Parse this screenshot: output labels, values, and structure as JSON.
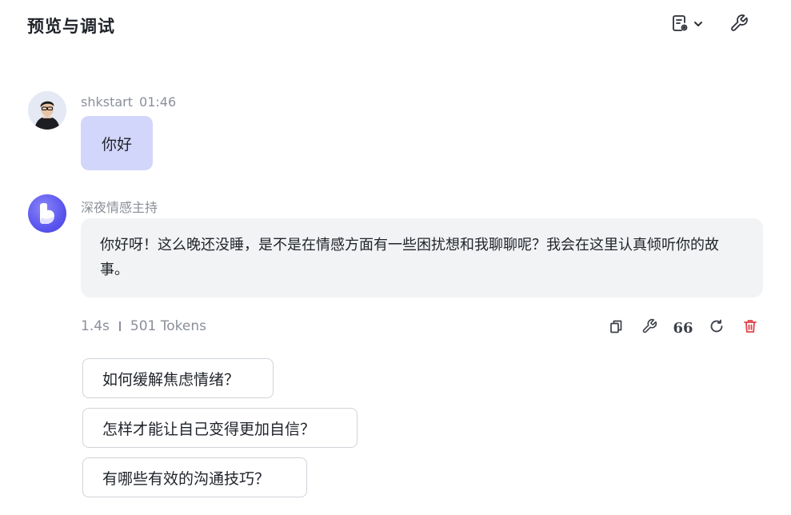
{
  "header": {
    "title": "预览与调试"
  },
  "messages": {
    "user": {
      "name": "shkstart",
      "time": "01:46",
      "text": "你好"
    },
    "bot": {
      "name": "深夜情感主持",
      "text": "你好呀！这么晚还没睡，是不是在情感方面有一些困扰想和我聊聊呢？我会在这里认真倾听你的故事。"
    }
  },
  "stats": {
    "duration": "1.4s",
    "tokens": "501 Tokens"
  },
  "actions": {
    "quote_glyph": "66",
    "icons": [
      "copy-icon",
      "wrench-icon",
      "quote-icon",
      "refresh-icon",
      "trash-icon"
    ],
    "delete_color": "#e0424b"
  },
  "suggestions": [
    "如何缓解焦虑情绪？",
    "怎样才能让自己变得更加自信？",
    "有哪些有效的沟通技巧？"
  ],
  "colors": {
    "user_bubble": "#d3d6fb",
    "bot_bubble": "#f2f3f5",
    "bot_avatar": "#5a55ee"
  }
}
